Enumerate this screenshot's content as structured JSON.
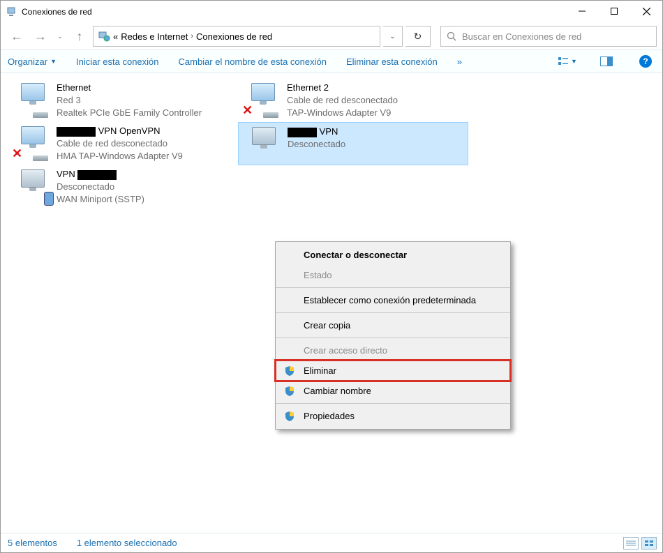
{
  "window": {
    "title": "Conexiones de red"
  },
  "breadcrumb": {
    "prefix": "«",
    "item1": "Redes e Internet",
    "item2": "Conexiones de red"
  },
  "search": {
    "placeholder": "Buscar en Conexiones de red"
  },
  "commandbar": {
    "organize": "Organizar",
    "start": "Iniciar esta conexión",
    "rename": "Cambiar el nombre de esta conexión",
    "delete": "Eliminar esta conexión",
    "more": "»"
  },
  "connections": [
    {
      "name": "Ethernet",
      "status": "Red 3",
      "device": "Realtek PCIe GbE Family Controller",
      "has_x": false,
      "has_cable": true
    },
    {
      "name": "Ethernet 2",
      "status": "Cable de red desconectado",
      "device": "TAP-Windows Adapter V9",
      "has_x": true,
      "has_cable": true
    },
    {
      "name_prefix_black_w": 56,
      "name_suffix": "VPN OpenVPN",
      "status": "Cable de red desconectado",
      "device": "HMA TAP-Windows Adapter V9",
      "has_x": true,
      "has_cable": true
    },
    {
      "name_prefix_black_w": 42,
      "name_suffix": "VPN",
      "status": "Desconectado",
      "device_hidden": true,
      "selected": true,
      "has_monitor": true
    },
    {
      "name_prefix": "VPN",
      "name_suffix_black_w": 56,
      "status": "Desconectado",
      "device": "WAN Miniport (SSTP)",
      "has_globe": true
    }
  ],
  "contextmenu": {
    "items": [
      {
        "label": "Conectar o desconectar",
        "bold": true
      },
      {
        "label": "Estado",
        "disabled": true
      },
      {
        "sep": true
      },
      {
        "label": "Establecer como conexión predeterminada"
      },
      {
        "sep": true
      },
      {
        "label": "Crear copia"
      },
      {
        "sep": true
      },
      {
        "label": "Crear acceso directo",
        "disabled": true
      },
      {
        "label": "Eliminar",
        "shield": true,
        "highlighted": true
      },
      {
        "label": "Cambiar nombre",
        "shield": true
      },
      {
        "sep": true
      },
      {
        "label": "Propiedades",
        "shield": true
      }
    ]
  },
  "statusbar": {
    "count": "5 elementos",
    "selected": "1 elemento seleccionado"
  }
}
